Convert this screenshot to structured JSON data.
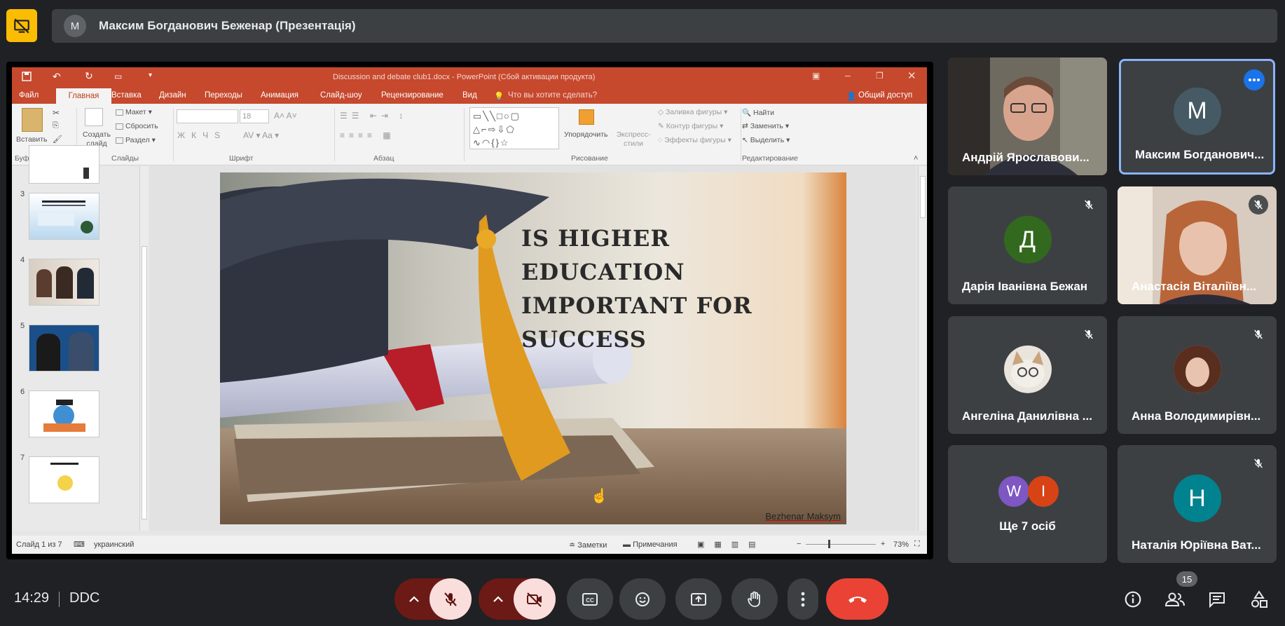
{
  "presentation_bar": {
    "avatar_letter": "M",
    "title": "Максим Богданович Беженар (Презентація)"
  },
  "powerpoint": {
    "window_title": "Discussion and debate club1.docx - PowerPoint (Сбой активации продукта)",
    "tabs": [
      "Файл",
      "Главная",
      "Вставка",
      "Дизайн",
      "Переходы",
      "Анимация",
      "Слайд-шоу",
      "Рецензирование",
      "Вид"
    ],
    "tell_me": "Что вы хотите сделать?",
    "share": "Общий доступ",
    "ribbon": {
      "paste": "Вставить",
      "new_slide": "Создать слайд",
      "layout": "Макет",
      "reset": "Сбросить",
      "section": "Раздел",
      "font_size": "18",
      "arrange": "Упорядочить",
      "quick_styles": "Экспресс-стили",
      "shape_fill": "Заливка фигуры",
      "shape_outline": "Контур фигуры",
      "shape_effects": "Эффекты фигуры",
      "find": "Найти",
      "replace": "Заменить",
      "select": "Выделить",
      "groups": [
        "Буфер обмена",
        "Слайды",
        "Шрифт",
        "Абзац",
        "Рисование",
        "Редактирование"
      ]
    },
    "thumbnail_numbers": [
      "3",
      "4",
      "5",
      "6",
      "7"
    ],
    "slide": {
      "title": "IS HIGHER EDUCATION IMPORTANT FOR SUCCESS",
      "author": "Bezhenar Maksym"
    },
    "status": {
      "slide_counter": "Слайд 1 из 7",
      "language": "украинский",
      "notes": "Заметки",
      "comments": "Примечания",
      "zoom": "73%"
    }
  },
  "participants": [
    {
      "name": "Андрій Ярославови...",
      "type": "video",
      "muted": false
    },
    {
      "name": "Максим Богданович...",
      "letter": "M",
      "color": "#455a64",
      "muted": false,
      "active": true
    },
    {
      "name": "Дарія Іванівна Бежан",
      "letter": "Д",
      "color": "#33691e",
      "muted": true
    },
    {
      "name": "Анастасія Віталіївн...",
      "type": "video",
      "muted": true
    },
    {
      "name": "Ангеліна Данилівна ...",
      "type": "photo",
      "muted": true
    },
    {
      "name": "Анна Володимирівн...",
      "type": "photo",
      "muted": true
    },
    {
      "name": "Ще 7 осіб",
      "letters": [
        "W",
        "I"
      ],
      "colors": [
        "#7e57c2",
        "#d84315"
      ]
    },
    {
      "name": "Наталія Юріївна Ват...",
      "letter": "Н",
      "color": "#00838f",
      "muted": true
    }
  ],
  "bottom_bar": {
    "time": "14:29",
    "meeting_code": "DDC",
    "participants_count": "15"
  },
  "colors": {
    "accent_blue": "#8ab4f8",
    "end_call_red": "#ea4335",
    "mute_pink": "#f9dedc",
    "ppt_orange": "#c6482d"
  }
}
